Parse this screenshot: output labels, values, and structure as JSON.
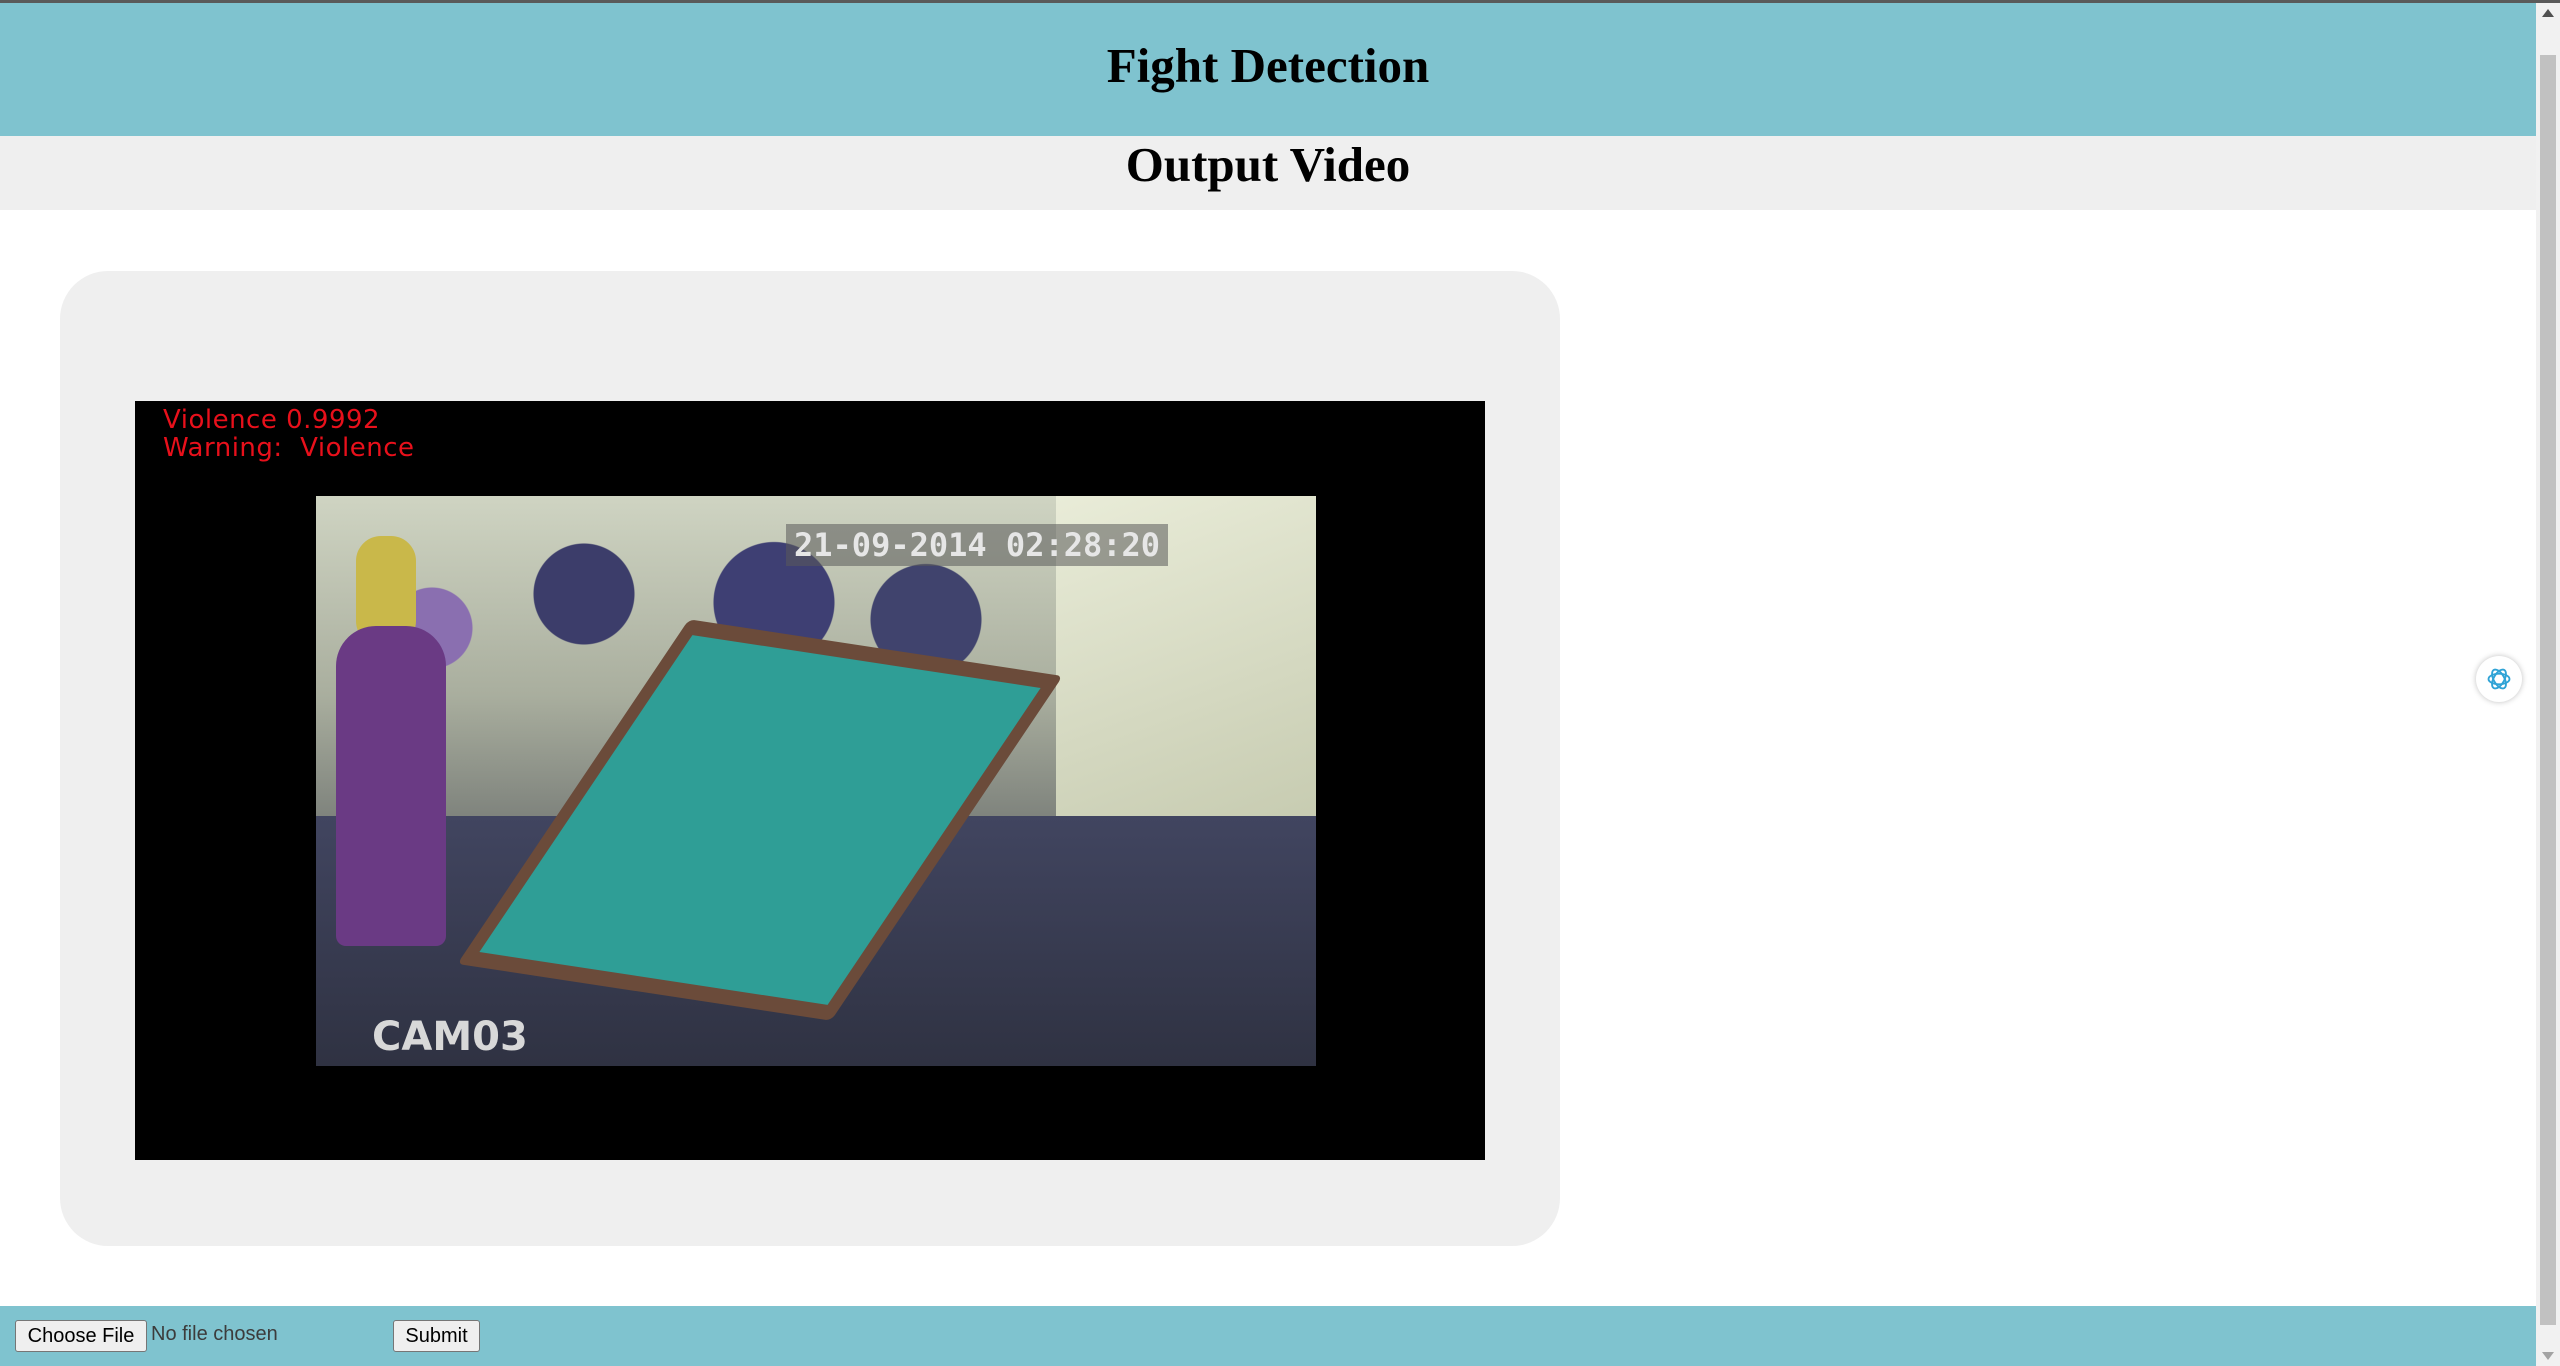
{
  "header": {
    "title": "Fight Detection"
  },
  "subheader": {
    "title": "Output Video"
  },
  "video": {
    "overlay_line1": "Violence 0.9992",
    "overlay_line2": "Warning:  Violence",
    "timestamp": "21-09-2014 02:28:20",
    "camera_label": "CAM03"
  },
  "form": {
    "choose_file_label": "Choose File",
    "file_status": "No file chosen",
    "submit_label": "Submit"
  },
  "colors": {
    "header_bg": "#7fc3cf",
    "panel_bg": "#efefef",
    "overlay_text": "#e8101b"
  },
  "icons": {
    "assistant": "assistant-swirl-icon"
  }
}
